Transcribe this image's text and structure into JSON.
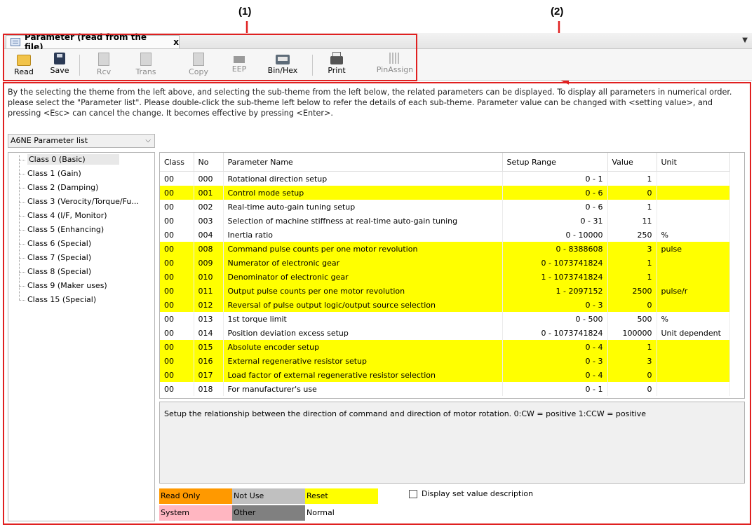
{
  "callouts": {
    "c1": "(1)",
    "c2": "(2)"
  },
  "tab": {
    "title": "Parameter (read from the file)",
    "close": "x",
    "dropdown": "▼"
  },
  "toolbar": {
    "buttons": [
      {
        "label": "Read",
        "icon": "folder-open-icon",
        "enabled": true
      },
      {
        "label": "Save",
        "icon": "floppy-disk-icon",
        "enabled": true
      },
      {
        "label": "Rcv",
        "icon": "receive-icon",
        "enabled": false
      },
      {
        "label": "Trans",
        "icon": "transmit-icon",
        "enabled": false
      },
      {
        "label": "Copy",
        "icon": "copy-icon",
        "enabled": false
      },
      {
        "label": "EEP",
        "icon": "eeprom-icon",
        "enabled": false
      },
      {
        "label": "Bin/Hex",
        "icon": "bin-hex-icon",
        "enabled": true
      },
      {
        "label": "Print",
        "icon": "printer-icon",
        "enabled": true
      },
      {
        "label": "PinAssign",
        "icon": "pin-assign-icon",
        "enabled": false
      }
    ]
  },
  "description": "By the selecting the theme from the left above, and selecting the sub-theme from the left below, the related parameters can be displayed. To display all parameters in numerical order. please select the \"Parameter list\". Please double-click the sub-theme left below to refer the details of each sub-theme. Parameter value can be changed with <setting value>, and pressing <Esc> can cancel the change. It becomes effective by pressing <Enter>.",
  "theme_select": {
    "value": "A6NE Parameter list"
  },
  "tree": [
    "Class 0 (Basic)",
    "Class 1 (Gain)",
    "Class 2 (Damping)",
    "Class 3 (Verocity/Torque/Fu...",
    "Class 4 (I/F, Monitor)",
    "Class 5 (Enhancing)",
    "Class 6 (Special)",
    "Class 7 (Special)",
    "Class 8 (Special)",
    "Class 9 (Maker uses)",
    "Class 15 (Special)"
  ],
  "table": {
    "headers": [
      "Class",
      "No",
      "Parameter Name",
      "Setup Range",
      "Value",
      "Unit"
    ],
    "rows": [
      {
        "cls": "00",
        "no": "000",
        "name": "Rotational direction setup",
        "range": "0 - 1",
        "value": "1",
        "unit": "",
        "status": "normal"
      },
      {
        "cls": "00",
        "no": "001",
        "name": "Control mode setup",
        "range": "0 - 6",
        "value": "0",
        "unit": "",
        "status": "reset"
      },
      {
        "cls": "00",
        "no": "002",
        "name": "Real-time auto-gain tuning setup",
        "range": "0 - 6",
        "value": "1",
        "unit": "",
        "status": "normal"
      },
      {
        "cls": "00",
        "no": "003",
        "name": "Selection of machine stiffness at real-time auto-gain tuning",
        "range": "0 - 31",
        "value": "11",
        "unit": "",
        "status": "normal"
      },
      {
        "cls": "00",
        "no": "004",
        "name": "Inertia ratio",
        "range": "0 - 10000",
        "value": "250",
        "unit": "%",
        "status": "normal"
      },
      {
        "cls": "00",
        "no": "008",
        "name": "Command pulse counts per one motor revolution",
        "range": "0 - 8388608",
        "value": "3",
        "unit": "pulse",
        "status": "reset"
      },
      {
        "cls": "00",
        "no": "009",
        "name": "Numerator of electronic gear",
        "range": "0 - 1073741824",
        "value": "1",
        "unit": "",
        "status": "reset"
      },
      {
        "cls": "00",
        "no": "010",
        "name": "Denominator of electronic gear",
        "range": "1 - 1073741824",
        "value": "1",
        "unit": "",
        "status": "reset"
      },
      {
        "cls": "00",
        "no": "011",
        "name": "Output pulse counts per one motor revolution",
        "range": "1 - 2097152",
        "value": "2500",
        "unit": "pulse/r",
        "status": "reset"
      },
      {
        "cls": "00",
        "no": "012",
        "name": "Reversal of pulse output logic/output source selection",
        "range": "0 - 3",
        "value": "0",
        "unit": "",
        "status": "reset"
      },
      {
        "cls": "00",
        "no": "013",
        "name": "1st torque limit",
        "range": "0 - 500",
        "value": "500",
        "unit": "%",
        "status": "normal"
      },
      {
        "cls": "00",
        "no": "014",
        "name": "Position deviation excess setup",
        "range": "0 - 1073741824",
        "value": "100000",
        "unit": "Unit dependent",
        "status": "normal"
      },
      {
        "cls": "00",
        "no": "015",
        "name": "Absolute encoder setup",
        "range": "0 - 4",
        "value": "1",
        "unit": "",
        "status": "reset"
      },
      {
        "cls": "00",
        "no": "016",
        "name": "External regenerative resistor setup",
        "range": "0 - 3",
        "value": "3",
        "unit": "",
        "status": "reset"
      },
      {
        "cls": "00",
        "no": "017",
        "name": "Load factor of external regenerative resistor selection",
        "range": "0 - 4",
        "value": "0",
        "unit": "",
        "status": "reset"
      },
      {
        "cls": "00",
        "no": "018",
        "name": "For manufacturer's use",
        "range": "0 - 1",
        "value": "0",
        "unit": "",
        "status": "normal"
      }
    ]
  },
  "info_text": "Setup the relationship between the direction of command and direction of motor rotation. 0:CW = positive 1:CCW = positive",
  "legend": {
    "read_only": "Read Only",
    "not_use": "Not Use",
    "reset": "Reset",
    "system": "System",
    "other": "Other",
    "normal": "Normal"
  },
  "checkbox_label": "Display set value description",
  "colors": {
    "highlight_red": "#e02020",
    "reset_yellow": "#ffff00",
    "read_only_orange": "#ff9900",
    "not_use_gray": "#c0c0c0",
    "system_pink": "#ffb6c1",
    "other_gray": "#808080",
    "normal_white": "#ffffff"
  }
}
